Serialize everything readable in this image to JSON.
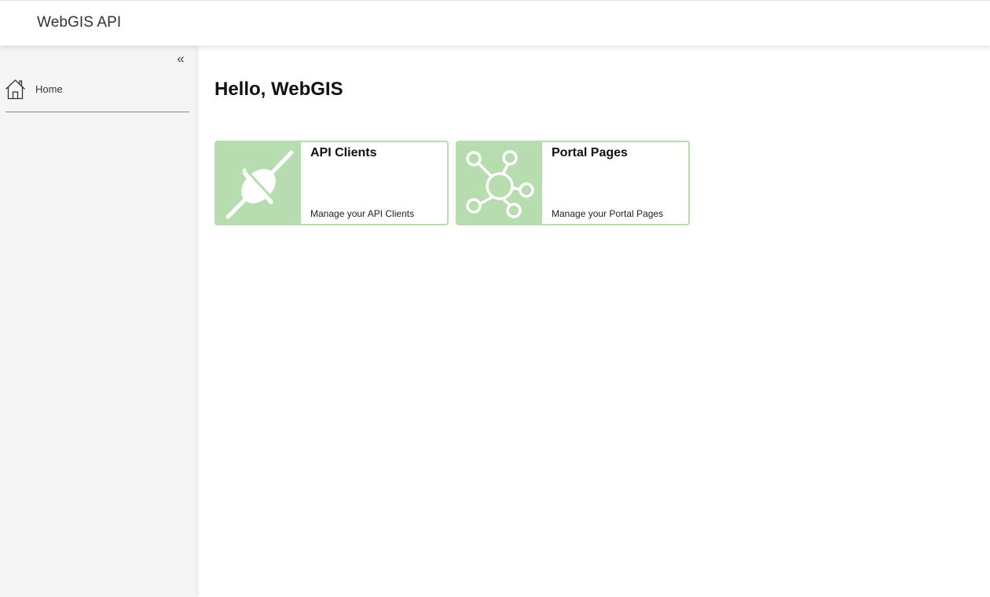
{
  "header": {
    "app_title": "WebGIS API"
  },
  "sidebar": {
    "collapse_label": "«",
    "items": [
      {
        "label": "Home",
        "icon": "home-icon"
      }
    ]
  },
  "main": {
    "greeting": "Hello, WebGIS",
    "cards": [
      {
        "title": "API Clients",
        "description": "Manage your API Clients",
        "icon": "plug-icon"
      },
      {
        "title": "Portal Pages",
        "description": "Manage your Portal Pages",
        "icon": "network-icon"
      }
    ]
  },
  "colors": {
    "accent_green": "#b6dcb0",
    "sidebar_bg": "#f5f5f5"
  }
}
